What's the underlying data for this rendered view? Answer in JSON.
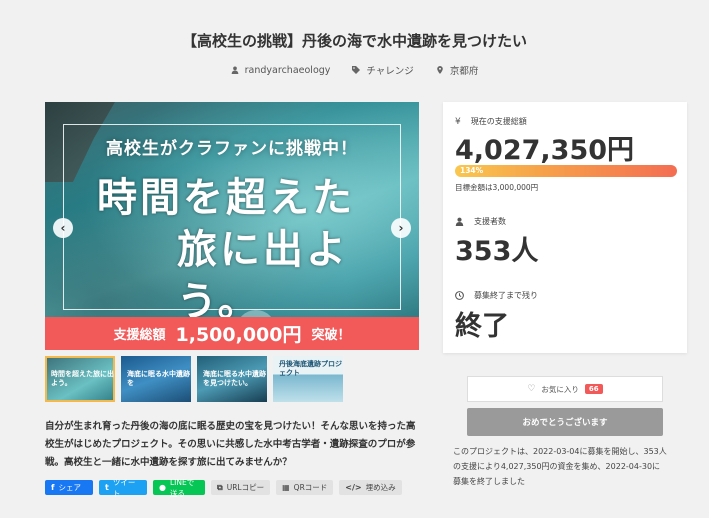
{
  "project": {
    "title": "【高校生の挑戦】丹後の海で水中遺跡を見つけたい",
    "author": "randyarchaeology",
    "category": "チャレンジ",
    "location": "京都府"
  },
  "hero": {
    "headline": "高校生がクラファンに挑戦中！",
    "brush_line1": "時間を超えた",
    "brush_line2": "旅に出よう。",
    "banner_prefix": "支援総額",
    "banner_amount": "1,500,000円",
    "banner_suffix": "突破！"
  },
  "thumbnails": [
    {
      "text": "時間を超えた旅に出よう。",
      "active": true
    },
    {
      "text": "海底に眠る水中遺跡を",
      "active": false
    },
    {
      "text": "海底に眠る水中遺跡を見つけたい。",
      "active": false
    },
    {
      "text": "丹後海底遺跡プロジェクト",
      "active": false
    }
  ],
  "description": "自分が生まれ育った丹後の海の底に眠る歴史の宝を見つけたい！そんな思いを持った高校生がはじめたプロジェクト。その思いに共感した水中考古学者・遺跡探査のプロが参戦。高校生と一緒に水中遺跡を探す旅に出てみませんか？",
  "share": {
    "facebook": "シェア",
    "twitter": "ツイート",
    "line": "LINEで送る",
    "url_copy": "URLコピー",
    "qr": "QRコード",
    "embed": "埋め込み"
  },
  "stats": {
    "funding_label": "現在の支援総額",
    "funding_value": "4,027,350円",
    "progress_percent": 134,
    "progress_text": "134%",
    "goal_text": "目標金額は3,000,000円",
    "backers_label": "支援者数",
    "backers_value": "353人",
    "remaining_label": "募集終了まで残り",
    "remaining_value": "終了"
  },
  "actions": {
    "favorite_label": "お気に入り",
    "favorite_count": "66",
    "congrats_label": "おめでとうございます"
  },
  "summary": "このプロジェクトは、2022-03-04に募集を開始し、353人の支援により4,027,350円の資金を集め、2022-04-30に募集を終了しました",
  "colors": {
    "accent": "#f25a5a",
    "background": "#f1f1f1",
    "progress_start": "#f9c74f",
    "progress_end": "#f46d52"
  }
}
